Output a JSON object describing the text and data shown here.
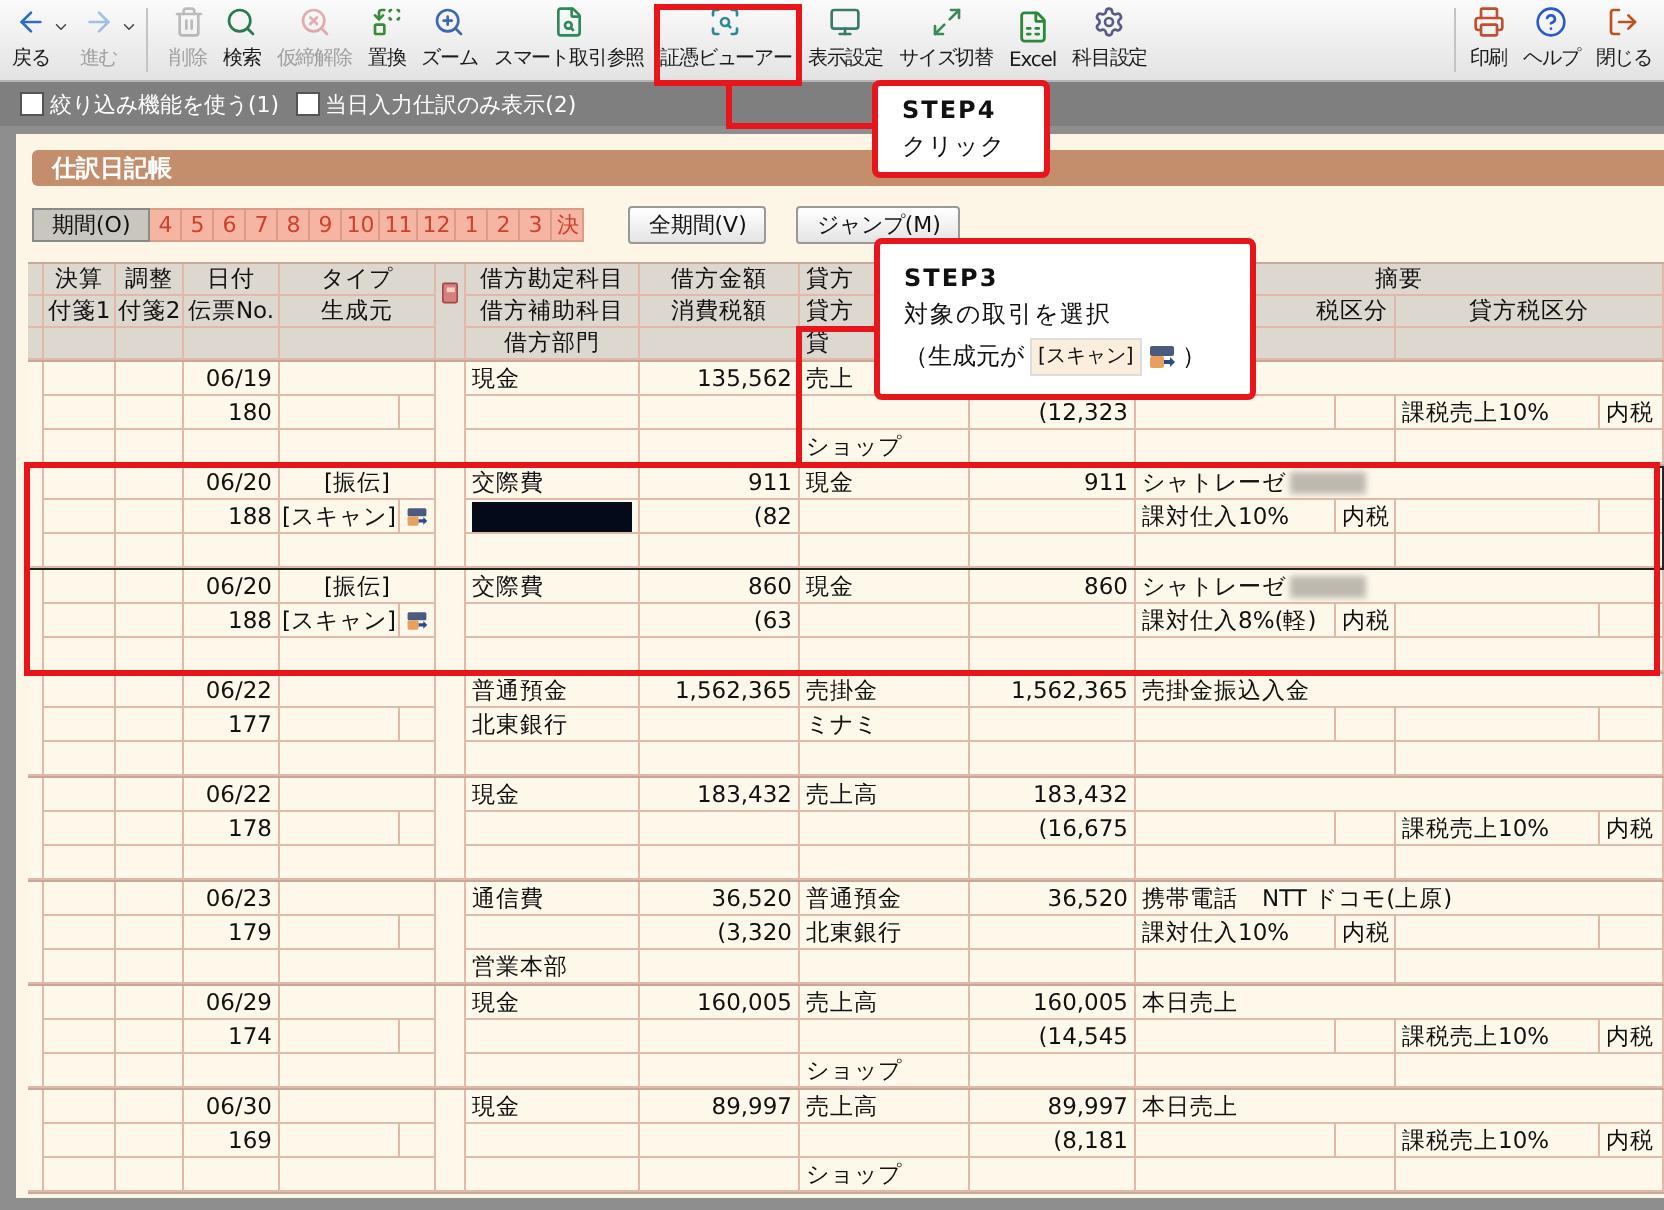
{
  "toolbar": {
    "items": [
      {
        "label": "戻る",
        "disabled": false,
        "dropdown": true
      },
      {
        "label": "進む",
        "disabled": true,
        "dropdown": true
      },
      {
        "label": "削除",
        "disabled": true,
        "dropdown": false
      },
      {
        "label": "検索",
        "disabled": false,
        "dropdown": false
      },
      {
        "label": "仮締解除",
        "disabled": true,
        "dropdown": false
      },
      {
        "label": "置換",
        "disabled": false,
        "dropdown": false
      },
      {
        "label": "ズーム",
        "disabled": false,
        "dropdown": false
      },
      {
        "label": "スマート取引参照",
        "disabled": false,
        "dropdown": false
      },
      {
        "label": "証憑ビューアー",
        "disabled": false,
        "dropdown": false
      },
      {
        "label": "表示設定",
        "disabled": false,
        "dropdown": false
      },
      {
        "label": "サイズ切替",
        "disabled": false,
        "dropdown": false
      },
      {
        "label": "Excel",
        "disabled": false,
        "dropdown": false
      },
      {
        "label": "科目設定",
        "disabled": false,
        "dropdown": false
      }
    ],
    "right_items": [
      {
        "label": "印刷",
        "disabled": false,
        "dropdown": false
      },
      {
        "label": "ヘルプ",
        "disabled": false,
        "dropdown": false
      },
      {
        "label": "閉じる",
        "disabled": false,
        "dropdown": false
      }
    ]
  },
  "filters": [
    {
      "label": "絞り込み機能を使う(1)",
      "checked": false
    },
    {
      "label": "当日入力仕訳のみ表示(2)",
      "checked": false
    }
  ],
  "panel": {
    "title": "仕訳日記帳"
  },
  "period": {
    "label": "期間(O)",
    "months": [
      {
        "label": "4",
        "selected": false
      },
      {
        "label": "5",
        "selected": false
      },
      {
        "label": "6",
        "selected": false
      },
      {
        "label": "7",
        "selected": false
      },
      {
        "label": "8",
        "selected": false
      },
      {
        "label": "9",
        "selected": false
      },
      {
        "label": "10",
        "selected": false
      },
      {
        "label": "11",
        "selected": false
      },
      {
        "label": "12",
        "selected": false
      },
      {
        "label": "1",
        "selected": false
      },
      {
        "label": "2",
        "selected": false
      },
      {
        "label": "3",
        "selected": false
      },
      {
        "label": "決",
        "selected": false
      }
    ],
    "buttons": [
      "全期間(V)",
      "ジャンプ(M)"
    ]
  },
  "table": {
    "header_rows": [
      {
        "settle": "決算",
        "adjust": "調整",
        "date": "日付",
        "type": "タイプ",
        "debit": "借方勘定科目",
        "debit_amount": "借方金額",
        "credit": "貸方",
        "memo": "摘要"
      },
      {
        "settle": "付箋1",
        "adjust": "付箋2",
        "date": "伝票No.",
        "type": "生成元",
        "debit": "借方補助科目",
        "debit_amount": "消費税額",
        "credit": "貸方",
        "memo_left": "税区分",
        "memo_right": "貸方税区分"
      },
      {
        "debit": "借方部門",
        "credit": "貸"
      }
    ],
    "entries": [
      {
        "selected": false,
        "date": "06/19",
        "slip_no": "180",
        "debit": "現金",
        "debit_amount": "135,562",
        "credit": "売上",
        "credit_tax": "(12,323",
        "credit_dept": "ショップ",
        "credit_tax_class": "課税売上10%",
        "credit_tax_kind": "内税"
      },
      {
        "selected": true,
        "date": "06/20",
        "slip_no": "188",
        "type": "[振伝]",
        "source": "[スキャン]",
        "scan_icon": true,
        "debit": "交際費",
        "debit_amount": "911",
        "debit_sub_redacted": true,
        "debit_tax": "(82",
        "credit": "現金",
        "credit_amount": "911",
        "memo": "シャトレーゼ",
        "memo_blurred": true,
        "debit_tax_class": "課対仕入10%",
        "debit_tax_kind": "内税"
      },
      {
        "selected": false,
        "date": "06/20",
        "slip_no": "188",
        "type": "[振伝]",
        "source": "[スキャン]",
        "scan_icon": true,
        "debit": "交際費",
        "debit_amount": "860",
        "debit_tax": "(63",
        "credit": "現金",
        "credit_amount": "860",
        "memo": "シャトレーゼ",
        "memo_blurred": true,
        "debit_tax_class": "課対仕入8%(軽)",
        "debit_tax_kind": "内税"
      },
      {
        "selected": false,
        "date": "06/22",
        "slip_no": "177",
        "debit": "普通預金",
        "debit_amount": "1,562,365",
        "debit_sub": "北東銀行",
        "credit": "売掛金",
        "credit_amount": "1,562,365",
        "credit_sub": "ミナミ",
        "memo": "売掛金振込入金"
      },
      {
        "selected": false,
        "date": "06/22",
        "slip_no": "178",
        "debit": "現金",
        "debit_amount": "183,432",
        "credit": "売上高",
        "credit_amount": "183,432",
        "credit_tax": "(16,675",
        "credit_tax_class": "課税売上10%",
        "credit_tax_kind": "内税"
      },
      {
        "selected": false,
        "date": "06/23",
        "slip_no": "179",
        "debit": "通信費",
        "debit_amount": "36,520",
        "debit_tax": "(3,320",
        "debit_dept": "営業本部",
        "credit": "普通預金",
        "credit_amount": "36,520",
        "credit_sub": "北東銀行",
        "memo": "携帯電話　NTT ドコモ(上原)",
        "debit_tax_class": "課対仕入10%",
        "debit_tax_kind": "内税"
      },
      {
        "selected": false,
        "date": "06/29",
        "slip_no": "174",
        "debit": "現金",
        "debit_amount": "160,005",
        "credit": "売上高",
        "credit_amount": "160,005",
        "credit_tax": "(14,545",
        "credit_dept": "ショップ",
        "memo": "本日売上",
        "credit_tax_class": "課税売上10%",
        "credit_tax_kind": "内税"
      },
      {
        "selected": false,
        "date": "06/30",
        "slip_no": "169",
        "debit": "現金",
        "debit_amount": "89,997",
        "credit": "売上高",
        "credit_amount": "89,997",
        "credit_tax": "(8,181",
        "credit_dept": "ショップ",
        "memo": "本日売上",
        "credit_tax_class": "課税売上10%",
        "credit_tax_kind": "内税"
      }
    ]
  },
  "annotations": [
    {
      "kind": "click",
      "step": "STEP4",
      "text": "クリック"
    },
    {
      "kind": "select",
      "step": "STEP3",
      "text": "対象の取引を選択",
      "note_prefix": "（生成元が",
      "note_badge": "[スキャン]",
      "note_suffix": "）"
    }
  ]
}
